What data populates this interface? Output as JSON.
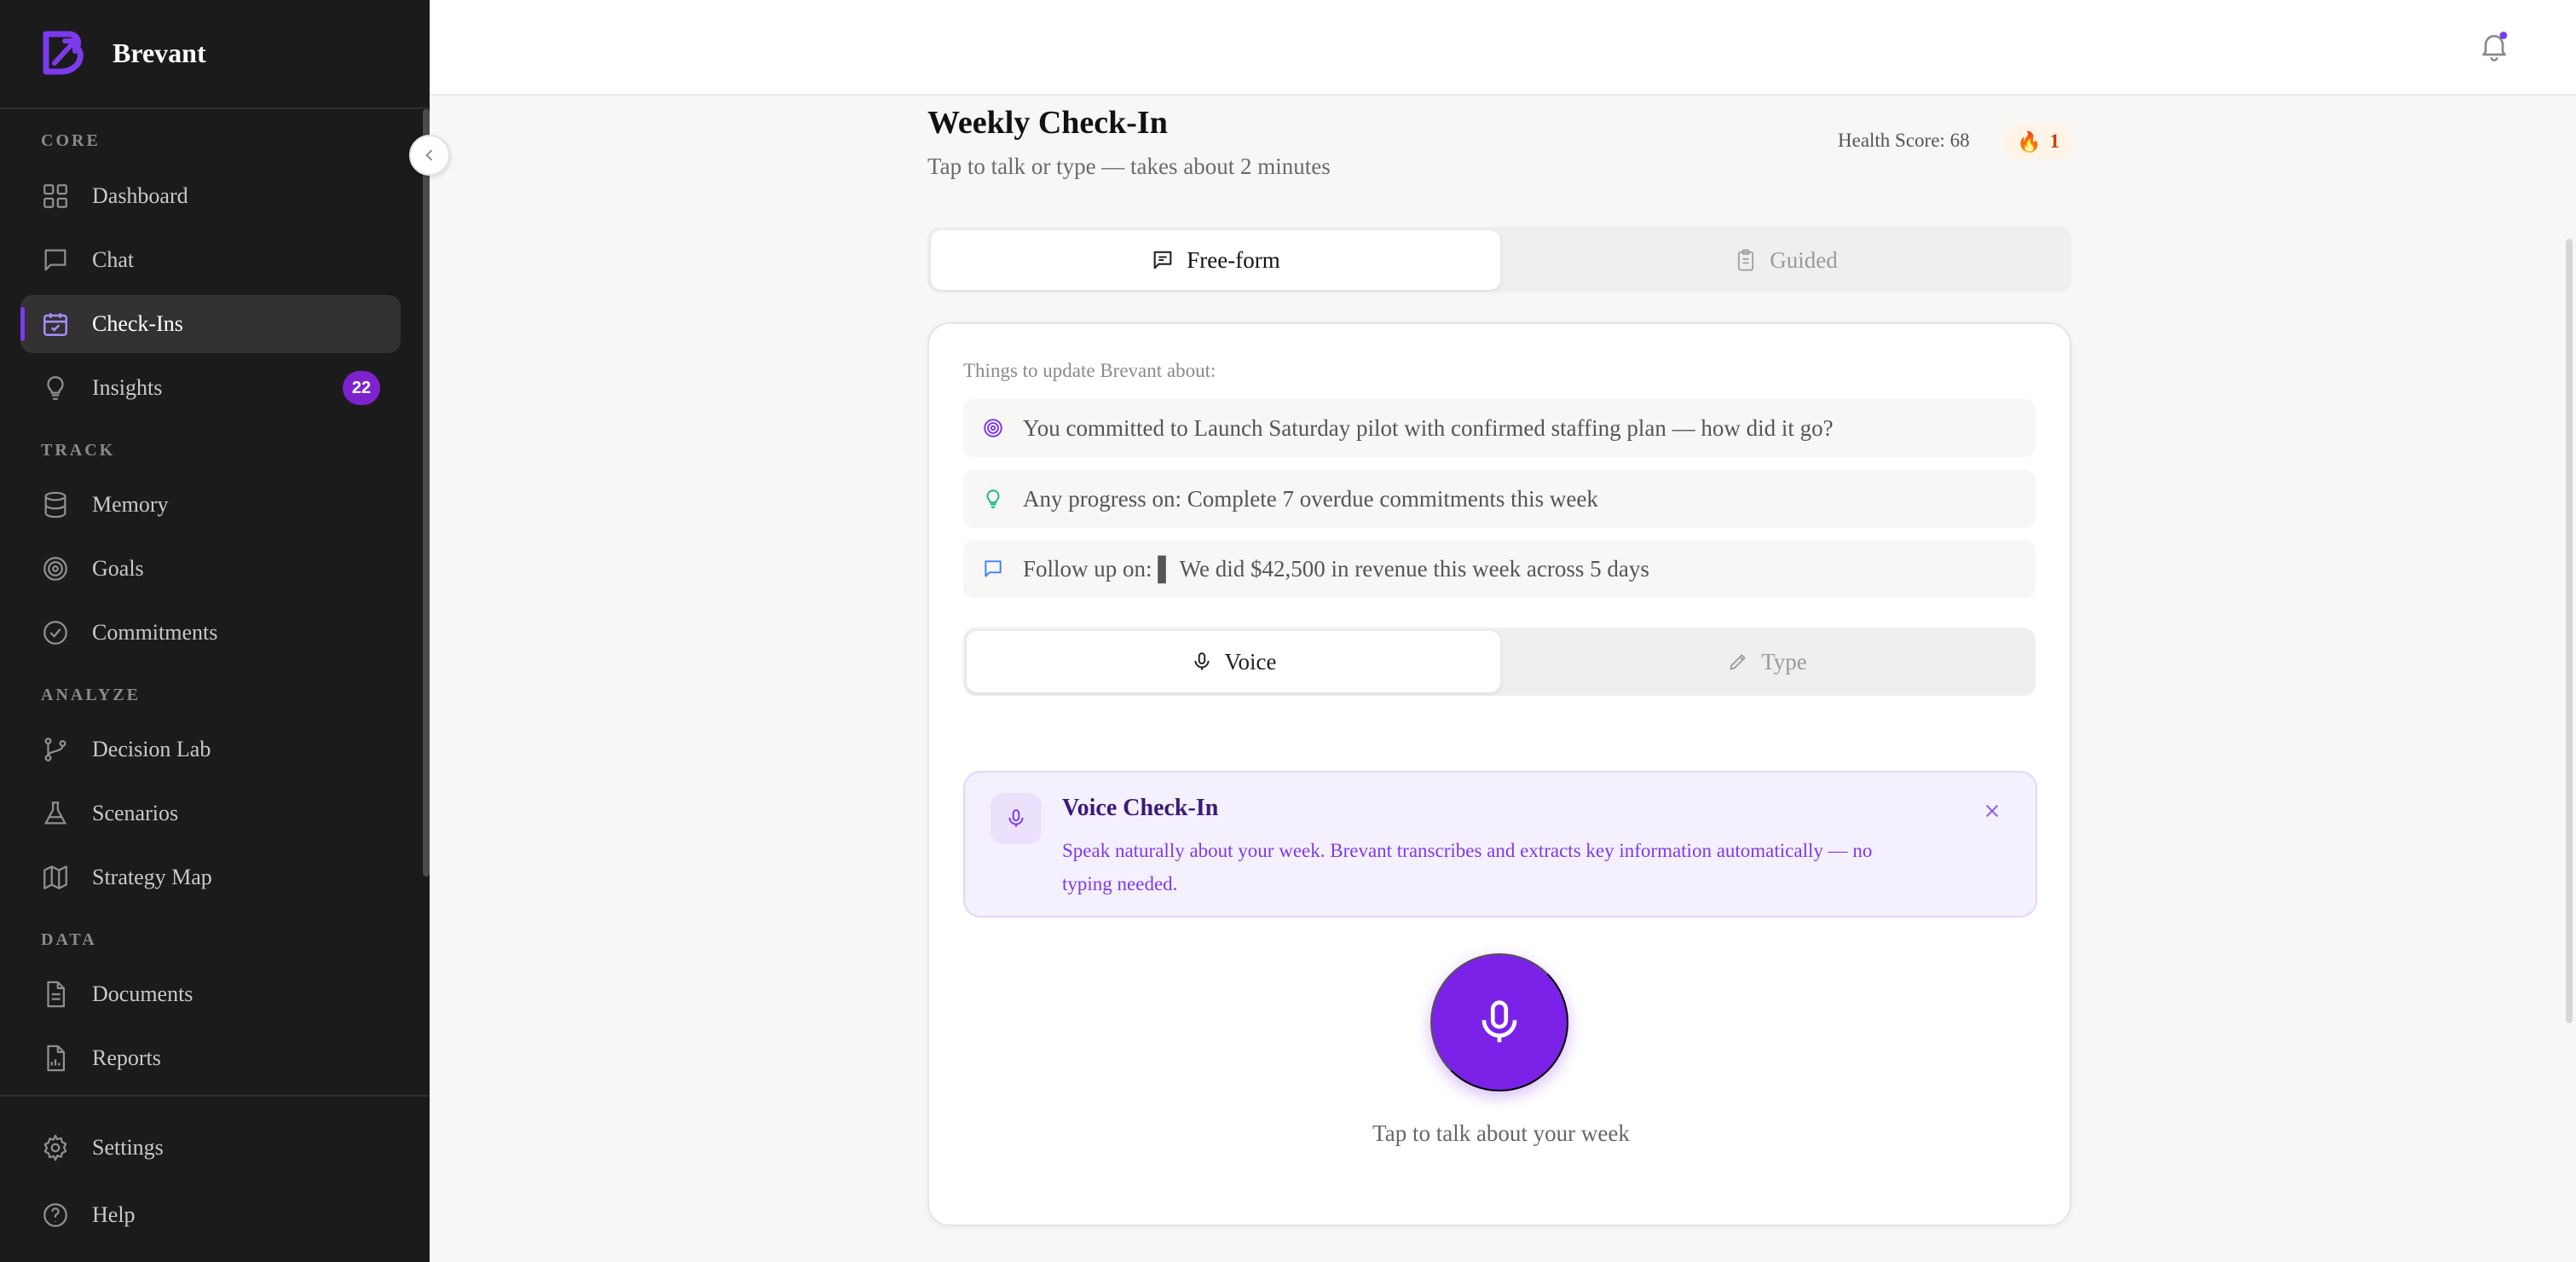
{
  "brand": {
    "name": "Brevant"
  },
  "sidebar": {
    "sections": {
      "core": "CORE",
      "track": "TRACK",
      "analyze": "ANALYZE",
      "data": "DATA"
    },
    "items": {
      "dashboard": "Dashboard",
      "chat": "Chat",
      "checkins": "Check-Ins",
      "insights": "Insights",
      "insights_badge": "22",
      "memory": "Memory",
      "goals": "Goals",
      "commitments": "Commitments",
      "decision_lab": "Decision Lab",
      "scenarios": "Scenarios",
      "strategy_map": "Strategy Map",
      "documents": "Documents",
      "reports": "Reports",
      "settings": "Settings",
      "help": "Help"
    },
    "active": "Check-Ins",
    "accent": "#7c3aed"
  },
  "header": {
    "title": "Weekly Check-In",
    "subtitle": "Tap to talk or type — takes about 2 minutes",
    "health_score": "Health Score: 68",
    "streak": "1"
  },
  "mode_tabs": {
    "freeform": "Free-form",
    "guided": "Guided"
  },
  "card": {
    "heading": "Things to update Brevant about:",
    "prompts": [
      {
        "icon": "target-icon",
        "text": "You committed to Launch Saturday pilot with confirmed staffing plan — how did it go?"
      },
      {
        "icon": "lightbulb-icon",
        "text": "Any progress on: Complete 7 overdue commitments this week"
      },
      {
        "icon": "message-icon",
        "text": "Follow up on: ▌  We did $42,500 in revenue this week across 5 days"
      }
    ],
    "input_tabs": {
      "voice": "Voice",
      "type": "Type"
    },
    "voice_banner": {
      "title": "Voice Check-In",
      "text": "Speak naturally about your week. Brevant transcribes and extracts key information automatically — no typing needed."
    },
    "mic_caption": "Tap to talk about your week"
  },
  "colors": {
    "primary": "#7c22e8",
    "sidebar_bg": "#1b1b1b"
  }
}
